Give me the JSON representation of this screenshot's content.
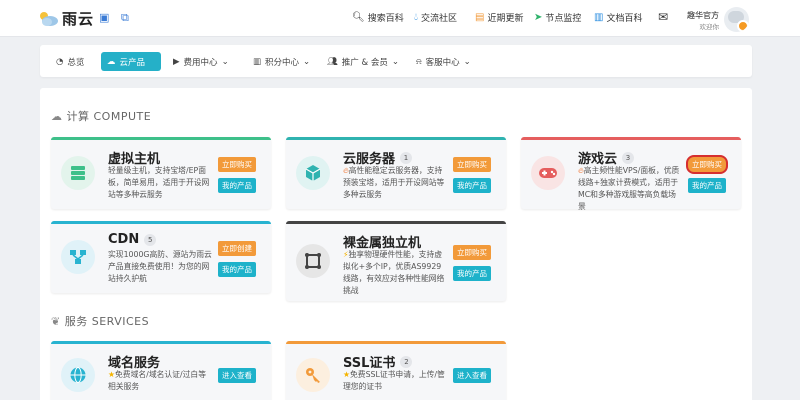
{
  "header": {
    "logo_text": "雨云",
    "nav": [
      {
        "label": "搜索百科",
        "icon": "search-icon"
      },
      {
        "label": "交流社区",
        "icon": "drop-icon"
      },
      {
        "label": "近期更新",
        "icon": "list-icon"
      },
      {
        "label": "节点监控",
        "icon": "send-icon"
      },
      {
        "label": "文档百科",
        "icon": "book-icon"
      }
    ],
    "user": {
      "name": "趣华官方",
      "role": "欢迎你"
    }
  },
  "tabs": [
    {
      "label": "总览",
      "icon": "dashboard-icon"
    },
    {
      "label": "云产品",
      "icon": "cloud-icon",
      "active": true
    },
    {
      "label": "费用中心",
      "icon": "video-icon"
    },
    {
      "label": "积分中心",
      "icon": "points-icon"
    },
    {
      "label": "推广 & 会员",
      "icon": "users-icon"
    },
    {
      "label": "客服中心",
      "icon": "support-icon"
    }
  ],
  "compute": {
    "title": "计算 COMPUTE",
    "cards": [
      {
        "title": "虚拟主机",
        "badge": "",
        "desc": "轻量级主机，支持宝塔/EP面板，简单易用，适用于开设网站等多种云服务",
        "btn1": "立即购买",
        "btn2": "我的产品",
        "color": "#3ec08a",
        "icon": "server-list-icon"
      },
      {
        "title": "云服务器",
        "badge": "1",
        "desc_prefix_icon": "fire",
        "desc": "高性能稳定云服务器，支持预装宝塔，适用于开设网站等多种云服务",
        "btn1": "立即购买",
        "btn2": "我的产品",
        "color": "#2fb3b0",
        "icon": "cube-icon"
      },
      {
        "title": "游戏云",
        "badge": "3",
        "desc_prefix_icon": "fire",
        "desc": "高主频性能VPS/面板，优质线路+独家计费模式，适用于MC和多种游戏服等高负载场景",
        "btn1": "立即购买",
        "btn2": "我的产品",
        "color": "#e55e5e",
        "icon": "gamepad-icon"
      },
      {
        "title": "CDN",
        "badge": "5",
        "desc": "实现1000G高防、源站为雨云产品直接免费使用！为您的网站持久护航",
        "btn1": "立即创建",
        "btn2": "我的产品",
        "color": "#28b3d0",
        "icon": "sitemap-icon"
      },
      {
        "title": "裸金属独立机",
        "badge": "",
        "desc_prefix_icon": "bolt",
        "desc": "独享物理硬件性能，支持虚拟化+多个IP，优质AS9929线路，有效应对各种性能网络挑战",
        "btn1": "立即购买",
        "btn2": "我的产品",
        "color": "#444444",
        "icon": "bare-metal-icon"
      }
    ]
  },
  "services": {
    "title": "服务 SERVICES",
    "cards": [
      {
        "title": "域名服务",
        "badge": "",
        "desc_prefix_icon": "star",
        "desc": "免费域名/域名认证/过白等相关服务",
        "btn1": "进入查看",
        "color": "#28b3d0",
        "icon": "globe-icon"
      },
      {
        "title": "SSL证书",
        "badge": "2",
        "desc_prefix_icon": "star",
        "desc": "免费SSL证书申请，上传/管理您的证书",
        "btn1": "进入查看",
        "color": "#f29a3a",
        "icon": "key-icon"
      }
    ]
  }
}
